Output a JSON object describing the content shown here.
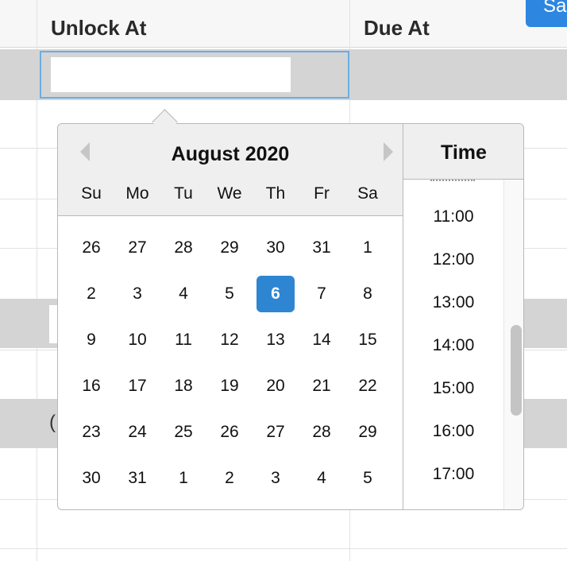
{
  "table": {
    "headers": {
      "unlock_at": "Unlock At",
      "due_at": "Due At"
    },
    "row_glyph": "("
  },
  "toolbar": {
    "save_label": "Sa"
  },
  "datepicker": {
    "month_title": "August 2020",
    "weekdays": [
      "Su",
      "Mo",
      "Tu",
      "We",
      "Th",
      "Fr",
      "Sa"
    ],
    "weeks": [
      [
        "26",
        "27",
        "28",
        "29",
        "30",
        "31",
        "1"
      ],
      [
        "2",
        "3",
        "4",
        "5",
        "6",
        "7",
        "8"
      ],
      [
        "9",
        "10",
        "11",
        "12",
        "13",
        "14",
        "15"
      ],
      [
        "16",
        "17",
        "18",
        "19",
        "20",
        "21",
        "22"
      ],
      [
        "23",
        "24",
        "25",
        "26",
        "27",
        "28",
        "29"
      ],
      [
        "30",
        "31",
        "1",
        "2",
        "3",
        "4",
        "5"
      ]
    ],
    "selected_day": "6",
    "selected_color": "#2e86d2",
    "prev_icon": "triangle-left-icon",
    "next_icon": "triangle-right-icon"
  },
  "time": {
    "title": "Time",
    "items": [
      "11:00",
      "12:00",
      "13:00",
      "14:00",
      "15:00",
      "16:00",
      "17:00"
    ]
  },
  "colors": {
    "accent": "#2d86e0",
    "focus_border": "#6aaee4",
    "row_band": "#d4d4d4"
  }
}
